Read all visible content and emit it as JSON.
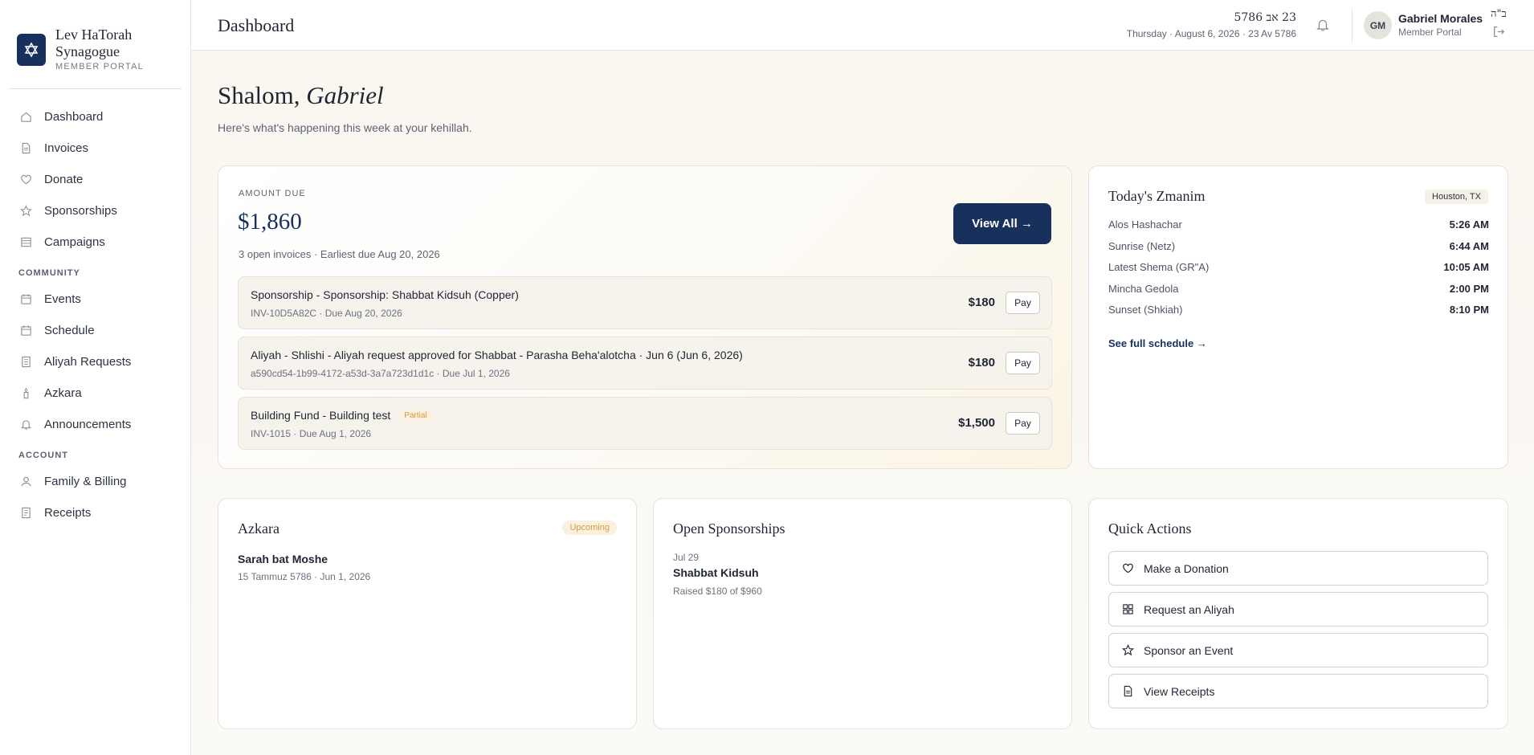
{
  "brand": {
    "name_line1": "Lev HaTorah",
    "name_line2": "Synagogue",
    "subtitle": "MEMBER PORTAL"
  },
  "sidebar": {
    "main_items": [
      {
        "label": "Dashboard",
        "icon": "home-icon"
      },
      {
        "label": "Invoices",
        "icon": "document-icon"
      },
      {
        "label": "Donate",
        "icon": "heart-icon"
      },
      {
        "label": "Sponsorships",
        "icon": "star-icon"
      },
      {
        "label": "Campaigns",
        "icon": "stack-icon"
      }
    ],
    "community_label": "COMMUNITY",
    "community_items": [
      {
        "label": "Events",
        "icon": "calendar-icon"
      },
      {
        "label": "Schedule",
        "icon": "calendar-icon"
      },
      {
        "label": "Aliyah Requests",
        "icon": "book-icon"
      },
      {
        "label": "Azkara",
        "icon": "candle-icon"
      },
      {
        "label": "Announcements",
        "icon": "bell-icon"
      }
    ],
    "account_label": "ACCOUNT",
    "account_items": [
      {
        "label": "Family & Billing",
        "icon": "user-icon"
      },
      {
        "label": "Receipts",
        "icon": "receipt-icon"
      }
    ]
  },
  "header": {
    "title": "Dashboard",
    "hebrew_date": "23 אב 5786",
    "date_line": "Thursday · August 6, 2026 · 23 Av 5786",
    "user_initials": "GM",
    "user_name": "Gabriel Morales",
    "user_role": "Member Portal",
    "bh": "ב\"ה"
  },
  "greeting": {
    "prefix": "Shalom, ",
    "name": "Gabriel",
    "subtitle": "Here's what's happening this week at your kehillah."
  },
  "amount_due": {
    "label": "AMOUNT DUE",
    "amount": "$1,860",
    "meta": "3 open invoices · Earliest due Aug 20, 2026",
    "view_all": "View All →",
    "invoices": [
      {
        "title": "Sponsorship - Sponsorship: Shabbat Kidsuh (Copper)",
        "meta": "INV-10D5A82C · Due Aug 20, 2026",
        "amount": "$180",
        "pay": "Pay",
        "badge": ""
      },
      {
        "title": "Aliyah - Shlishi - Aliyah request approved for Shabbat - Parasha Beha'alotcha · Jun 6 (Jun 6, 2026)",
        "meta": "a590cd54-1b99-4172-a53d-3a7a723d1d1c · Due Jul 1, 2026",
        "amount": "$180",
        "pay": "Pay",
        "badge": ""
      },
      {
        "title": "Building Fund - Building test",
        "meta": "INV-1015 · Due Aug 1, 2026",
        "amount": "$1,500",
        "pay": "Pay",
        "badge": "Partial"
      }
    ]
  },
  "zmanim": {
    "title": "Today's Zmanim",
    "location": "Houston, TX",
    "rows": [
      {
        "name": "Alos Hashachar",
        "time": "5:26 AM"
      },
      {
        "name": "Sunrise (Netz)",
        "time": "6:44 AM"
      },
      {
        "name": "Latest Shema (GR\"A)",
        "time": "10:05 AM"
      },
      {
        "name": "Mincha Gedola",
        "time": "2:00 PM"
      },
      {
        "name": "Sunset (Shkiah)",
        "time": "8:10 PM"
      }
    ],
    "link": "See full schedule →"
  },
  "azkara": {
    "title": "Azkara",
    "badge": "Upcoming",
    "name": "Sarah bat Moshe",
    "date": "15 Tammuz 5786 · Jun 1, 2026"
  },
  "sponsorships": {
    "title": "Open Sponsorships",
    "date": "Jul 29",
    "name": "Shabbat Kidsuh",
    "raised": "Raised $180 of $960"
  },
  "quick_actions": {
    "title": "Quick Actions",
    "items": [
      {
        "label": "Make a Donation",
        "icon": "heart-icon"
      },
      {
        "label": "Request an Aliyah",
        "icon": "grid-icon"
      },
      {
        "label": "Sponsor an Event",
        "icon": "star-icon"
      },
      {
        "label": "View Receipts",
        "icon": "document-icon"
      }
    ]
  },
  "colors": {
    "brand_navy": "#17305c",
    "badge_amber": "#d49a45",
    "page_bg": "#faf6ef"
  }
}
